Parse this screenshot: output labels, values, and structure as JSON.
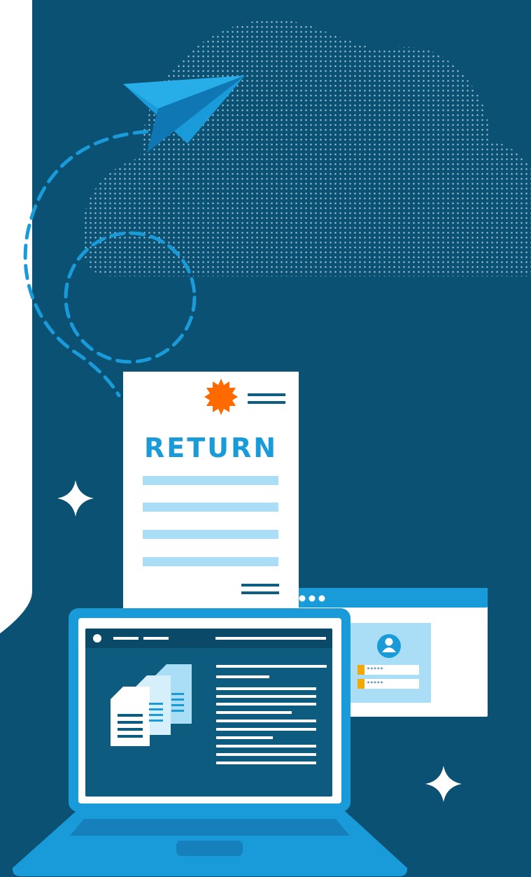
{
  "document": {
    "title": "RETURN"
  },
  "login_window": {
    "password_mask_1": "*****",
    "password_mask_2": "*****"
  },
  "icons": [
    "paper-plane-icon",
    "cloud-icon",
    "seal-badge-icon",
    "sparkle-icon",
    "user-avatar-icon",
    "file-stack-icon",
    "laptop-icon"
  ],
  "colors": {
    "navy_background": "#0b5174",
    "accent_blue": "#1a9bd9",
    "light_blue": "#a9def6",
    "orange_seal": "#ff6a00",
    "dark_navy": "#0a4a68"
  }
}
